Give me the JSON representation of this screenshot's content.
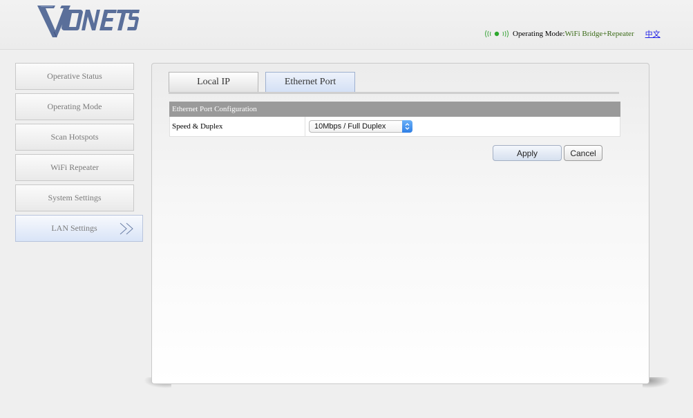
{
  "header": {
    "logo_text": "VONETS",
    "mode_label": "Operating Mode:",
    "mode_value": "WiFi Bridge+Repeater",
    "language_link": "中文"
  },
  "sidebar": {
    "items": [
      {
        "label": "Operative Status"
      },
      {
        "label": "Operating Mode"
      },
      {
        "label": "Scan Hotspots"
      },
      {
        "label": "WiFi Repeater"
      },
      {
        "label": "System Settings"
      },
      {
        "label": "LAN Settings"
      }
    ],
    "active_index": 5
  },
  "tabs": [
    {
      "label": "Local IP"
    },
    {
      "label": "Ethernet Port"
    }
  ],
  "config": {
    "title": "Ethernet Port Configuration",
    "rows": [
      {
        "label": "Speed & Duplex",
        "value": "10Mbps / Full Duplex"
      }
    ]
  },
  "buttons": {
    "apply": "Apply",
    "cancel": "Cancel"
  },
  "colors": {
    "accent_blue": "#2f7fe6",
    "mode_value_green": "#3a6a17",
    "logo_blue": "#5a6f9a"
  }
}
